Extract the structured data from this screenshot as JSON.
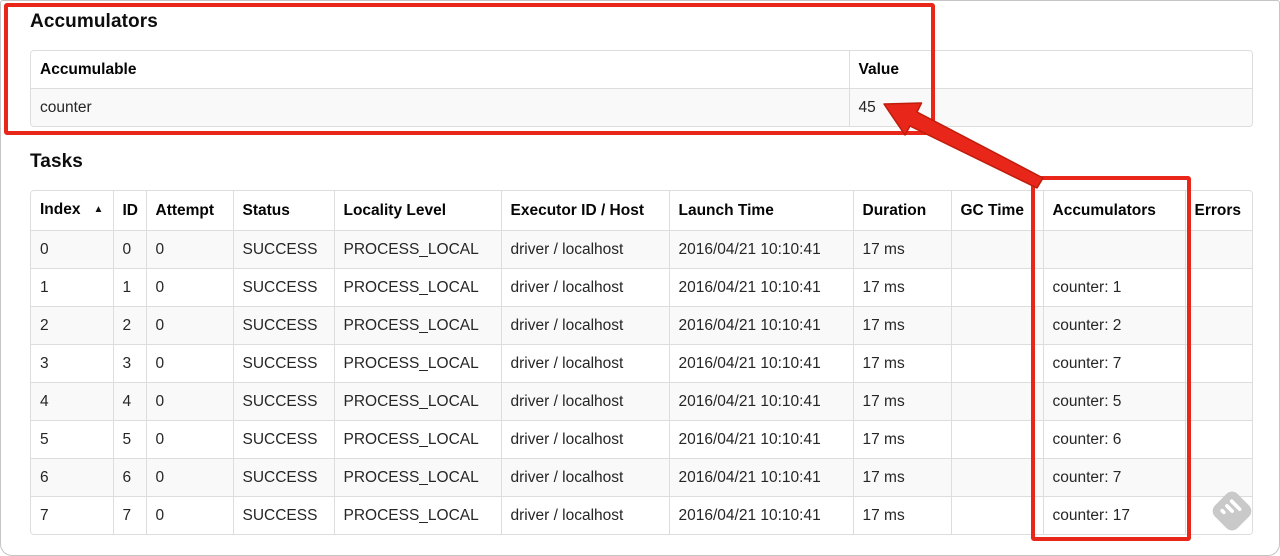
{
  "accumulators_section": {
    "heading": "Accumulators",
    "table": {
      "columns": [
        "Accumulable",
        "Value"
      ],
      "rows": [
        [
          "counter",
          "45"
        ]
      ]
    }
  },
  "tasks_section": {
    "heading": "Tasks",
    "table": {
      "columns": [
        "Index",
        "ID",
        "Attempt",
        "Status",
        "Locality Level",
        "Executor ID / Host",
        "Launch Time",
        "Duration",
        "GC Time",
        "Accumulators",
        "Errors"
      ],
      "sort_icon": "▲",
      "sorted_column": "Index",
      "rows": [
        [
          "0",
          "0",
          "0",
          "SUCCESS",
          "PROCESS_LOCAL",
          "driver / localhost",
          "2016/04/21 10:10:41",
          "17 ms",
          "",
          "",
          ""
        ],
        [
          "1",
          "1",
          "0",
          "SUCCESS",
          "PROCESS_LOCAL",
          "driver / localhost",
          "2016/04/21 10:10:41",
          "17 ms",
          "",
          "counter: 1",
          ""
        ],
        [
          "2",
          "2",
          "0",
          "SUCCESS",
          "PROCESS_LOCAL",
          "driver / localhost",
          "2016/04/21 10:10:41",
          "17 ms",
          "",
          "counter: 2",
          ""
        ],
        [
          "3",
          "3",
          "0",
          "SUCCESS",
          "PROCESS_LOCAL",
          "driver / localhost",
          "2016/04/21 10:10:41",
          "17 ms",
          "",
          "counter: 7",
          ""
        ],
        [
          "4",
          "4",
          "0",
          "SUCCESS",
          "PROCESS_LOCAL",
          "driver / localhost",
          "2016/04/21 10:10:41",
          "17 ms",
          "",
          "counter: 5",
          ""
        ],
        [
          "5",
          "5",
          "0",
          "SUCCESS",
          "PROCESS_LOCAL",
          "driver / localhost",
          "2016/04/21 10:10:41",
          "17 ms",
          "",
          "counter: 6",
          ""
        ],
        [
          "6",
          "6",
          "0",
          "SUCCESS",
          "PROCESS_LOCAL",
          "driver / localhost",
          "2016/04/21 10:10:41",
          "17 ms",
          "",
          "counter: 7",
          ""
        ],
        [
          "7",
          "7",
          "0",
          "SUCCESS",
          "PROCESS_LOCAL",
          "driver / localhost",
          "2016/04/21 10:10:41",
          "17 ms",
          "",
          "counter: 17",
          ""
        ]
      ]
    }
  },
  "annotations": {
    "color": "#e8261a",
    "outline_color": "#c01d0c",
    "box1_target": "accumulators summary table",
    "box2_target": "accumulators column in tasks table",
    "arrow_points_to": "45"
  },
  "watermark": {
    "icon": "skitch-watermark",
    "color": "#c9c9c9"
  }
}
